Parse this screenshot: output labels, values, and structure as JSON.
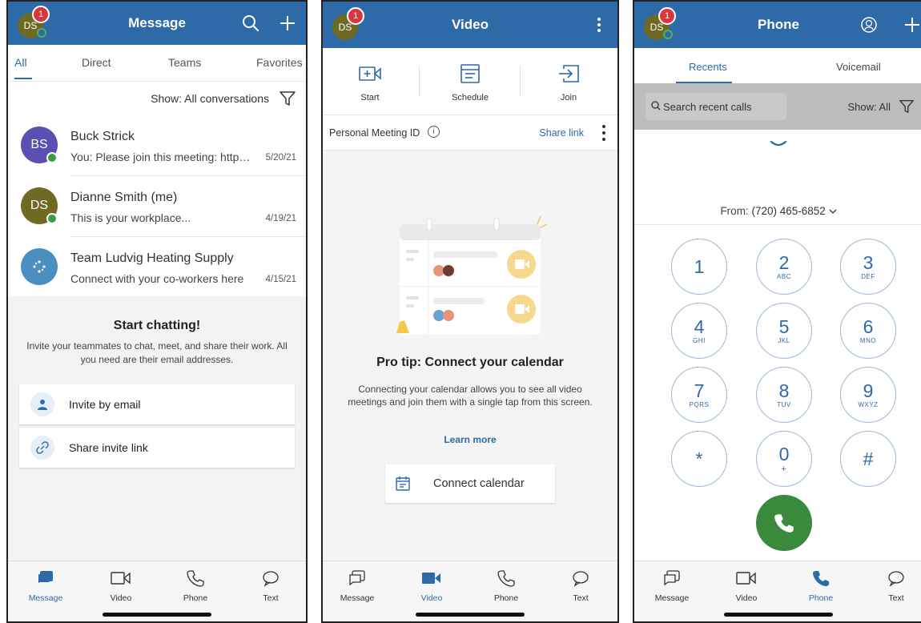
{
  "colors": {
    "brand": "#2e6aa8",
    "badge": "#d9363e",
    "presence": "#3f9a44",
    "call": "#3a8a3c"
  },
  "user": {
    "initials": "DS",
    "badge_count": "1"
  },
  "message_screen": {
    "title": "Message",
    "tabs": [
      "All",
      "Direct",
      "Teams",
      "Favorites"
    ],
    "filter_label": "Show: All conversations",
    "conversations": [
      {
        "initials": "BS",
        "avatar_color": "#5b4fb4",
        "name": "Buck Strick",
        "preview": "You: Please join this meeting: https://meet.example.com",
        "date": "5/20/21"
      },
      {
        "initials": "DS",
        "avatar_color": "#6e6a23",
        "name": "Dianne Smith (me)",
        "preview": "This is your workplace...",
        "date": "4/19/21"
      },
      {
        "initials": "",
        "avatar_color": "#4a8ec2",
        "name": "Team Ludvig Heating Supply",
        "preview": "Connect with your co-workers here",
        "date": "4/15/21"
      }
    ],
    "start_title": "Start chatting!",
    "start_subtitle": "Invite your teammates to chat, meet, and share their work. All you need are their email addresses.",
    "actions": [
      "Invite by email",
      "Share invite link"
    ]
  },
  "video_screen": {
    "title": "Video",
    "actions": [
      "Start",
      "Schedule",
      "Join"
    ],
    "pmi_label": "Personal Meeting ID",
    "share_link": "Share link",
    "tip_title": "Pro tip: Connect your calendar",
    "tip_text": "Connecting your calendar allows you to see all video meetings and join them with a single tap from this screen.",
    "learn_more": "Learn more",
    "connect_calendar": "Connect calendar"
  },
  "phone_screen": {
    "title": "Phone",
    "tabs": [
      "Recents",
      "Voicemail"
    ],
    "search_placeholder": "Search recent calls",
    "show_filter": "Show: All",
    "from_label": "From:",
    "from_number": "(720) 465-6852",
    "keys": [
      {
        "d": "1",
        "s": ""
      },
      {
        "d": "2",
        "s": "ABC"
      },
      {
        "d": "3",
        "s": "DEF"
      },
      {
        "d": "4",
        "s": "GHI"
      },
      {
        "d": "5",
        "s": "JKL"
      },
      {
        "d": "6",
        "s": "MNO"
      },
      {
        "d": "7",
        "s": "PQRS"
      },
      {
        "d": "8",
        "s": "TUV"
      },
      {
        "d": "9",
        "s": "WXYZ"
      },
      {
        "d": "*",
        "s": ""
      },
      {
        "d": "0",
        "s": "+"
      },
      {
        "d": "#",
        "s": ""
      }
    ]
  },
  "bottom_nav": [
    "Message",
    "Video",
    "Phone",
    "Text"
  ]
}
